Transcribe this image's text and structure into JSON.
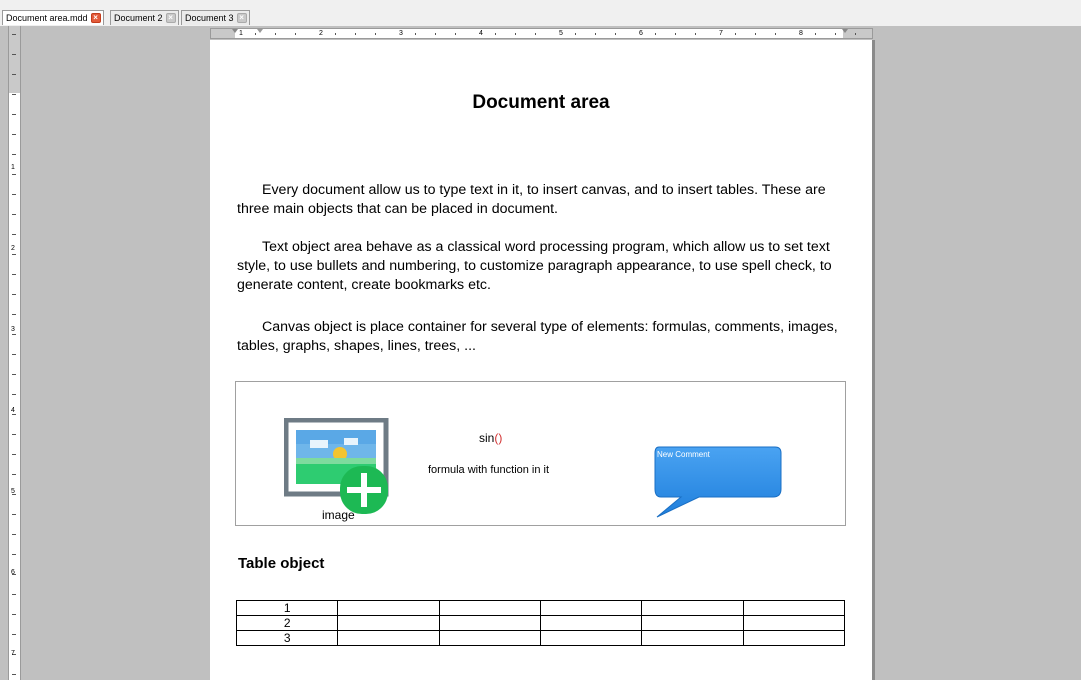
{
  "tabs": [
    {
      "label": "Document area.mdd",
      "active": true
    },
    {
      "label": "Document 2",
      "active": false
    },
    {
      "label": "Document 3",
      "active": false
    }
  ],
  "hruler_numbers": [
    "1",
    "2",
    "3",
    "4",
    "5",
    "6",
    "7",
    "8"
  ],
  "vruler_numbers": [
    "1",
    "2",
    "3",
    "4",
    "5",
    "6",
    "7"
  ],
  "document": {
    "title": "Document area",
    "paragraphs": [
      "Every document allow us to type text in it, to insert canvas, and to insert tables. These are three main objects that can be placed in document.",
      "Text object area behave as a classical word processing program, which allow us to set text style, to use bullets and numbering, to customize paragraph appearance, to use spell check, to generate content, create bookmarks etc.",
      "Canvas object is place container for several type of elements: formulas, comments, images, tables, graphs, shapes, lines, trees, ..."
    ],
    "canvas": {
      "image_caption": "image",
      "formula_text": "sin",
      "formula_bracket": "()",
      "formula_caption": "formula with function in it",
      "comment_text": "New Comment"
    },
    "table_title": "Table object",
    "table_rows": [
      [
        "1",
        "",
        "",
        "",
        "",
        ""
      ],
      [
        "2",
        "",
        "",
        "",
        "",
        ""
      ],
      [
        "3",
        "",
        "",
        "",
        "",
        ""
      ]
    ]
  },
  "colors": {
    "comment_fill": "#2b8ae6",
    "image_frame": "#6e7b85",
    "tab_close_active": "#e35b3a"
  },
  "icons": {
    "tab_close": "close-icon",
    "image_placeholder": "image-add-icon",
    "comment_bubble": "speech-bubble-icon"
  }
}
